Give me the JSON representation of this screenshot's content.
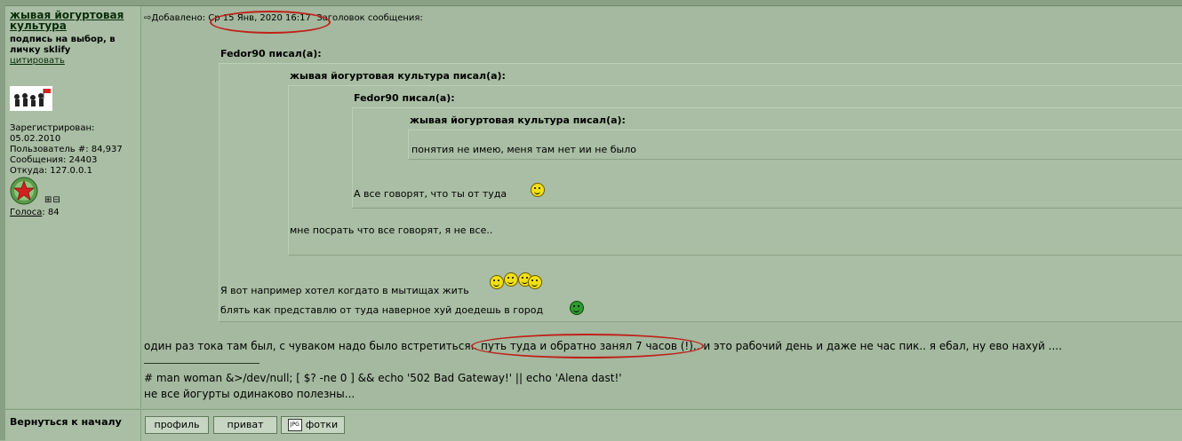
{
  "author": {
    "name": "жывая йогуртовая культура",
    "signature": "подпись на выбор, в личку sklify",
    "quote_link": "цитировать",
    "info": {
      "registered_label": "Зарегистрирован:",
      "registered_date": "05.02.2010",
      "user_number": "Пользователь #: 84,937",
      "posts": "Сообщения: 24403",
      "from": "Откуда: 127.0.0.1"
    },
    "pm_icons": "⊞⊟",
    "votes_label": "Голоса",
    "votes_value": ": 84"
  },
  "post": {
    "header_added": "Добавлено:",
    "header_date": "Ср 15 Янв, 2020 16:17",
    "header_subject": "Заголовок сообщения:",
    "quotes": {
      "q1_author": "Fedor90 писал(а):",
      "q2_author": "жывая йогуртовая культура писал(а):",
      "q3_author": "Fedor90 писал(а):",
      "q4_author": "жывая йогуртовая культура писал(а):",
      "q4_text": "понятия не имею, меня там нет ии не было",
      "q3_text": "А все говорят, что ты от туда",
      "q2_text": "мне посрать что все говорят, я не все..",
      "q1_line1": "Я вот например хотел когдато в мытищах жить",
      "q1_line2": "блять как представлю от туда наверное хуй доедешь в город"
    },
    "main_text": "один раз тока там был, с чуваком надо было встретиться.. путь туда и обратно занял 7 часов (!).. и это рабочий день и даже не час пик.. я ебал, ну ево нахуй ....",
    "signature_lines": [
      "# man woman &>/dev/null; [ $? -ne 0 ] && echo '502 Bad Gateway!' || echo 'Alena dast!'",
      "не все йогурты одинаково полезны..."
    ]
  },
  "bottom": {
    "back_to_top": "Вернуться к началу",
    "btn_profile": "профиль",
    "btn_private": "приват",
    "btn_photos": "фотки",
    "photos_icon_text": "JPG"
  },
  "colors": {
    "page_bg": "#9fb59a",
    "panel_bg": "#a9bea4",
    "annotation_red": "#c0201a"
  }
}
